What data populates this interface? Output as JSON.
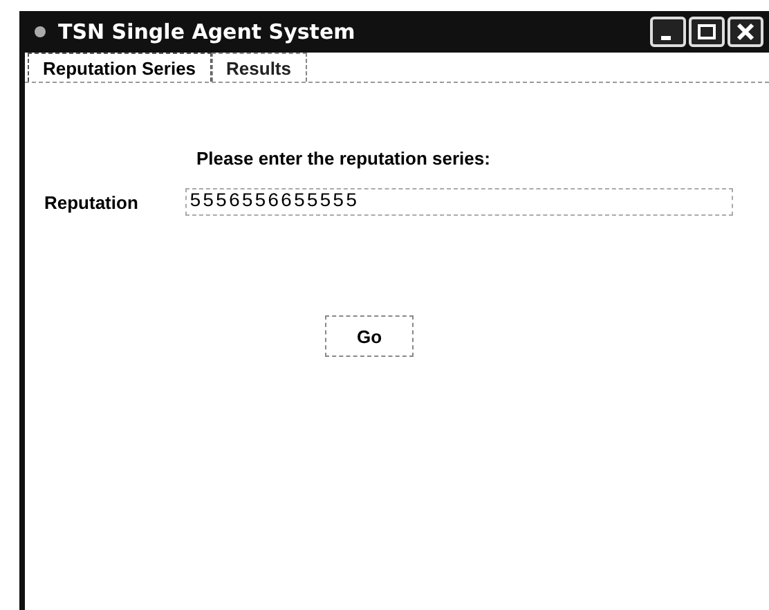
{
  "window": {
    "title": "TSN Single Agent System"
  },
  "tabs": [
    {
      "label": "Reputation Series",
      "selected": true
    },
    {
      "label": "Results",
      "selected": false
    }
  ],
  "prompt": "Please enter the reputation series:",
  "field": {
    "label": "Reputation",
    "value": "5556556655555"
  },
  "buttons": [
    "Go"
  ]
}
